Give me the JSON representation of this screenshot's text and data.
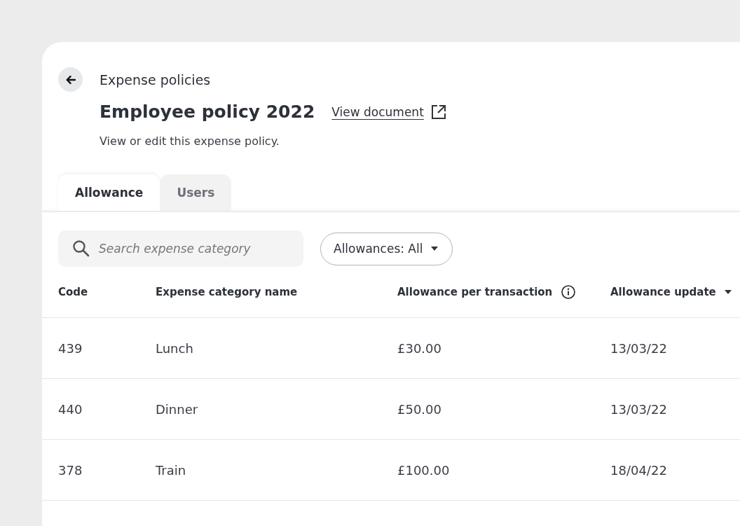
{
  "breadcrumb": "Expense policies",
  "title": "Employee policy 2022",
  "document_link": "View document",
  "description": "View or edit this expense policy.",
  "tabs": [
    {
      "label": "Allowance",
      "selected": true
    },
    {
      "label": "Users",
      "selected": false
    }
  ],
  "search": {
    "placeholder": "Search expense category"
  },
  "filter": {
    "label": "Allowances: All"
  },
  "table": {
    "columns": [
      {
        "label": "Code",
        "kind": "plain"
      },
      {
        "label": "Expense category name",
        "kind": "plain"
      },
      {
        "label": "Allowance per transaction",
        "kind": "info"
      },
      {
        "label": "Allowance update",
        "kind": "sortable"
      }
    ],
    "rows": [
      [
        "439",
        "Lunch",
        "£30.00",
        "13/03/22"
      ],
      [
        "440",
        "Dinner",
        "£50.00",
        "13/03/22"
      ],
      [
        "378",
        "Train",
        "£100.00",
        "18/04/22"
      ]
    ]
  }
}
